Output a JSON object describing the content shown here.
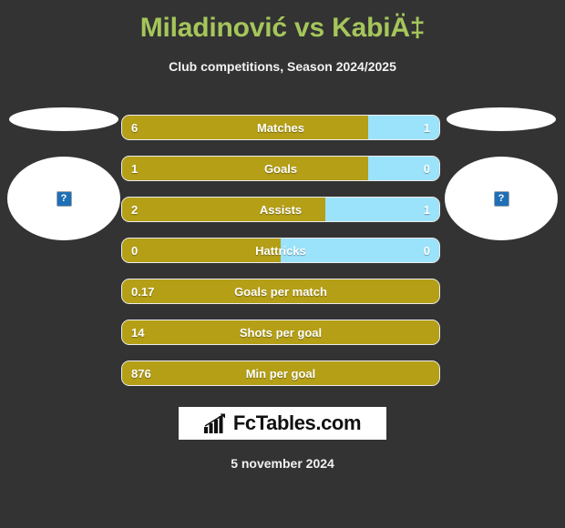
{
  "header": {
    "title": "Miladinović vs KabiÄ‡",
    "subtitle": "Club competitions, Season 2024/2025"
  },
  "colors": {
    "background": "#333333",
    "title": "#a5c65a",
    "home_bar": "#b49f17",
    "away_bar": "#9be3fb",
    "bar_border": "#ececec",
    "text": "#ffffff"
  },
  "players": {
    "home": {
      "name": "",
      "photo_icon": "broken-image-icon",
      "photo_glyph": "?"
    },
    "away": {
      "name": "",
      "photo_icon": "broken-image-icon",
      "photo_glyph": "?"
    }
  },
  "stats": [
    {
      "label": "Matches",
      "home": "6",
      "away": "1",
      "home_pct": 77.5,
      "split": true
    },
    {
      "label": "Goals",
      "home": "1",
      "away": "0",
      "home_pct": 77.5,
      "split": true
    },
    {
      "label": "Assists",
      "home": "2",
      "away": "1",
      "home_pct": 64.0,
      "split": true
    },
    {
      "label": "Hattricks",
      "home": "0",
      "away": "0",
      "home_pct": 50.0,
      "split": true
    },
    {
      "label": "Goals per match",
      "home": "0.17",
      "away": "",
      "home_pct": 100,
      "split": false
    },
    {
      "label": "Shots per goal",
      "home": "14",
      "away": "",
      "home_pct": 100,
      "split": false
    },
    {
      "label": "Min per goal",
      "home": "876",
      "away": "",
      "home_pct": 100,
      "split": false
    }
  ],
  "footer": {
    "logo_text": "FcTables.com",
    "logo_icon": "bar-chart-arrow-icon",
    "date": "5 november 2024"
  }
}
